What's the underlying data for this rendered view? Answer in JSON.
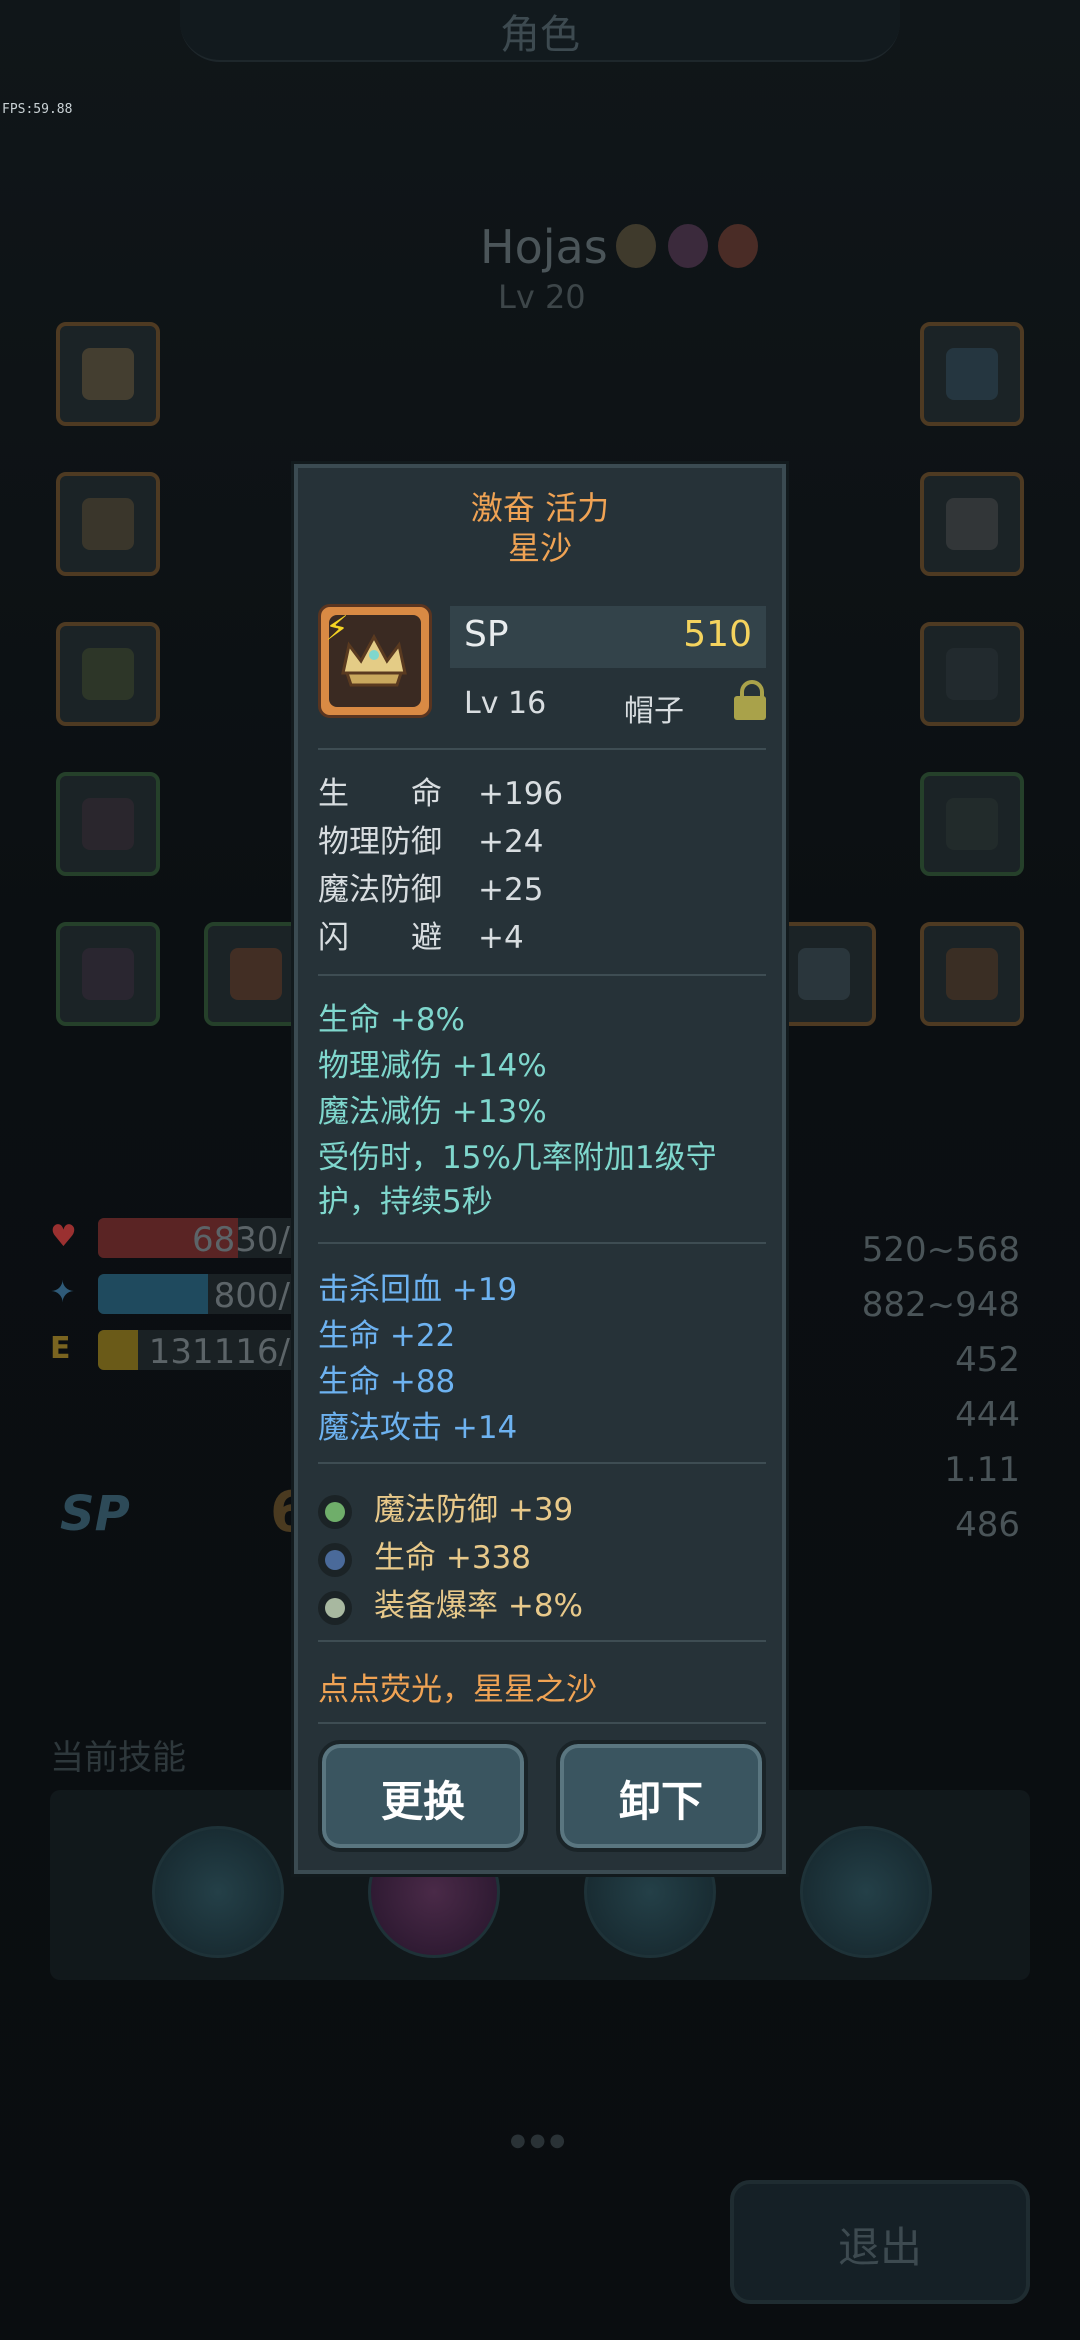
{
  "screen": {
    "title": "角色",
    "fps": "FPS:59.88"
  },
  "hero": {
    "name": "Hojas",
    "level": "Lv 20"
  },
  "background_stats": {
    "hp": "6830/",
    "mp": "800/",
    "exp": "131116/",
    "right_values": [
      "520~568",
      "882~948",
      "452",
      "444",
      "1.11",
      "486"
    ],
    "sp_label": "SP",
    "sp_value_partial": "6"
  },
  "skills": {
    "label": "当前技能"
  },
  "exit_label": "退出",
  "popup": {
    "title_line1": "激奋 活力",
    "title_line2": "星沙",
    "sp_label": "SP",
    "sp_value": "510",
    "level": "Lv 16",
    "slot": "帽子",
    "base_stats": [
      {
        "label": "生　　命",
        "value": "+196"
      },
      {
        "label": "物理防御",
        "value": "+24"
      },
      {
        "label": "魔法防御",
        "value": "+25"
      },
      {
        "label": "闪　　避",
        "value": "+4"
      }
    ],
    "special_stats": [
      "生命 +8%",
      "物理减伤 +14%",
      "魔法减伤 +13%",
      "受伤时，15%几率附加1级守护，持续5秒"
    ],
    "random_stats": [
      "击杀回血 +19",
      "生命 +22",
      "生命 +88",
      "魔法攻击 +14"
    ],
    "gem_stats": [
      "魔法防御 +39",
      "生命 +338",
      "装备爆率 +8%"
    ],
    "flavor": "点点荧光，星星之沙",
    "replace_label": "更换",
    "unequip_label": "卸下"
  }
}
